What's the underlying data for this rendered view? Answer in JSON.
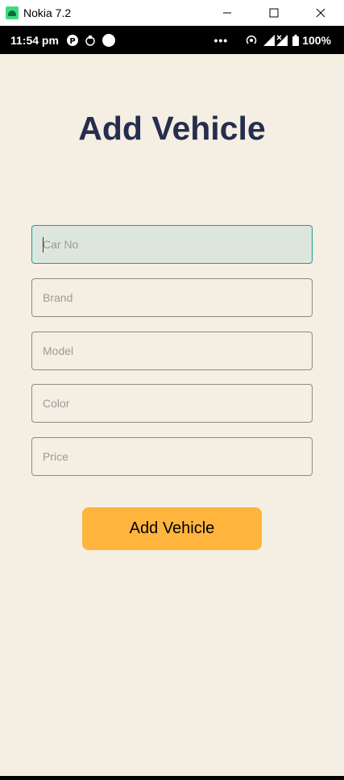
{
  "window": {
    "title": "Nokia 7.2",
    "minimize_icon": "minimize-icon",
    "maximize_icon": "maximize-icon",
    "close_icon": "close-icon"
  },
  "status_bar": {
    "time": "11:54 pm",
    "icons_left": [
      "p-notification-icon",
      "sync-icon",
      "circle-icon"
    ],
    "more": "•••",
    "icons_right": [
      "hotspot-icon",
      "signal-icon",
      "signal-x-icon",
      "battery-icon"
    ],
    "battery": "100%"
  },
  "page": {
    "title": "Add Vehicle"
  },
  "form": {
    "car_no": {
      "placeholder": "Car No",
      "value": ""
    },
    "brand": {
      "placeholder": "Brand",
      "value": ""
    },
    "model": {
      "placeholder": "Model",
      "value": ""
    },
    "color": {
      "placeholder": "Color",
      "value": ""
    },
    "price": {
      "placeholder": "Price",
      "value": ""
    },
    "submit_label": "Add Vehicle"
  },
  "colors": {
    "background": "#f4efe2",
    "title": "#262d50",
    "button": "#ffb43e",
    "focused_field_bg": "#dde6dc",
    "focused_field_border": "#1a9ba0"
  }
}
